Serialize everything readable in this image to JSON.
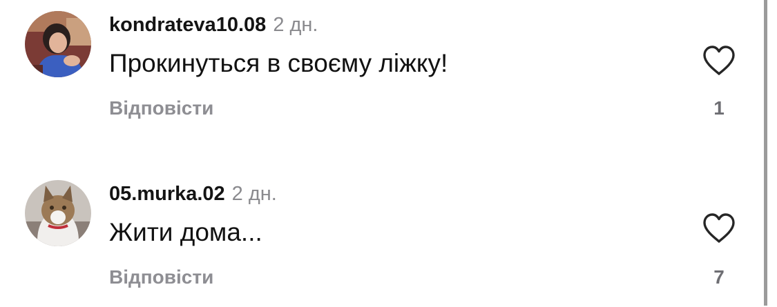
{
  "comments": [
    {
      "username": "kondrateva10.08",
      "time": "2 дн.",
      "text": "Прокинуться в своєму ліжку!",
      "reply_label": "Відповісти",
      "likes": "1",
      "like_icon": "heart-outline-icon"
    },
    {
      "username": "05.murka.02",
      "time": "2 дн.",
      "text": "Жити дома...",
      "reply_label": "Відповісти",
      "likes": "7",
      "like_icon": "heart-outline-icon"
    }
  ],
  "colors": {
    "secondary_text": "#8e8e93",
    "scrollbar": "#9b9b9b"
  }
}
